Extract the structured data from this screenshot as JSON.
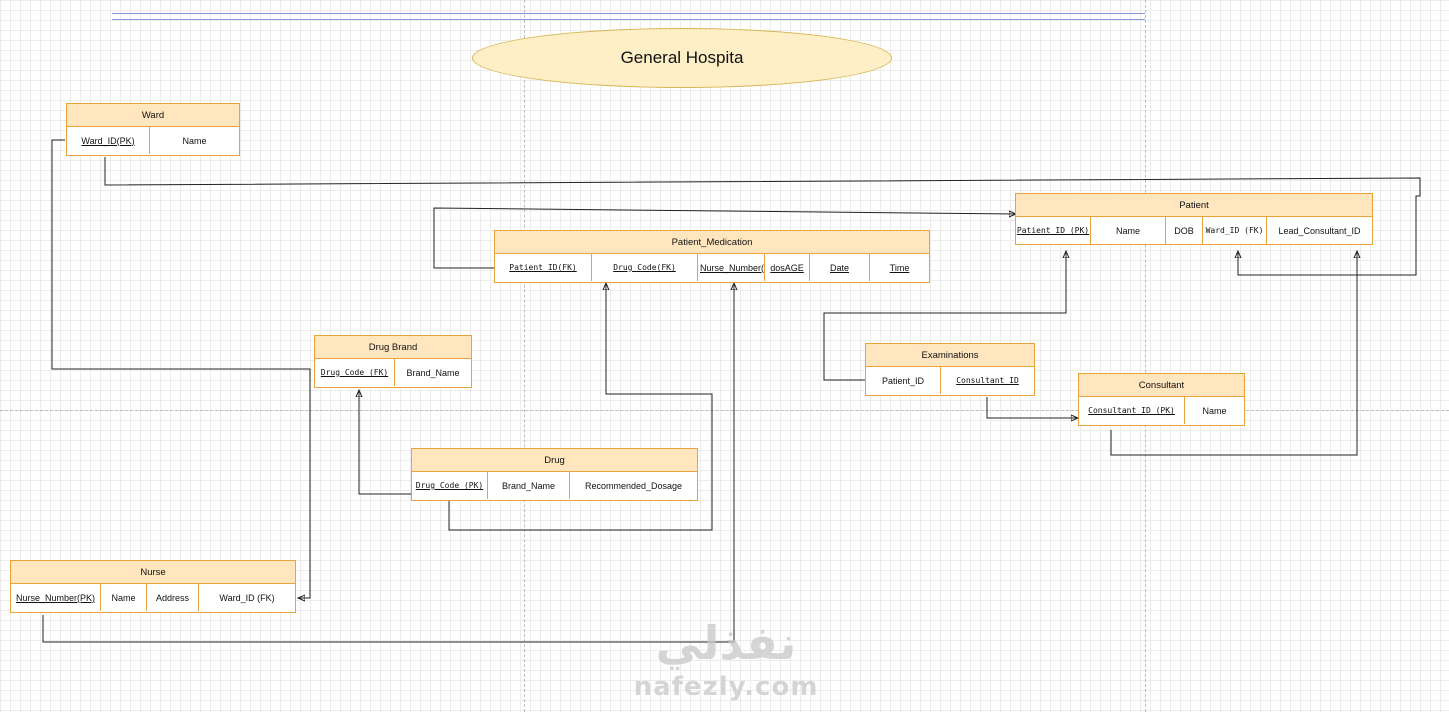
{
  "title": "General Hospita",
  "entities": {
    "ward": {
      "name": "Ward",
      "attributes": [
        "Ward_ID(PK)",
        "Name"
      ]
    },
    "patient": {
      "name": "Patient",
      "attributes": [
        "Patient_ID (PK)",
        "Name",
        "DOB",
        "Ward_ID (FK)",
        "Lead_Consultant_ID"
      ]
    },
    "patient_medication": {
      "name": "Patient_Medication",
      "attributes": [
        "Patient_ID(FK)",
        "Drug_Code(FK)",
        "Nurse_Number(FK)",
        "dosAGE",
        "Date",
        "Time"
      ]
    },
    "drug_brand": {
      "name": "Drug Brand",
      "attributes": [
        "Drug_Code (FK)",
        "Brand_Name"
      ]
    },
    "examinations": {
      "name": "Examinations",
      "attributes": [
        "Patient_ID",
        "Consultant_ID"
      ]
    },
    "consultant": {
      "name": "Consultant",
      "attributes": [
        "Consultant_ID (PK)",
        "Name"
      ]
    },
    "drug": {
      "name": "Drug",
      "attributes": [
        "Drug_Code (PK)",
        "Brand_Name",
        "Recommended_Dosage"
      ]
    },
    "nurse": {
      "name": "Nurse",
      "attributes": [
        "Nurse_Number(PK)",
        "Name",
        "Address",
        "Ward_ID (FK)"
      ]
    }
  },
  "watermark": {
    "arabic": "نفذلي",
    "latin": "nafezly.com"
  },
  "colors": {
    "entity_header": "#ffe6bf",
    "entity_border": "#e8a33a",
    "title_fill": "#ffefc6",
    "title_border": "#d6b656",
    "connector": "#222222"
  }
}
